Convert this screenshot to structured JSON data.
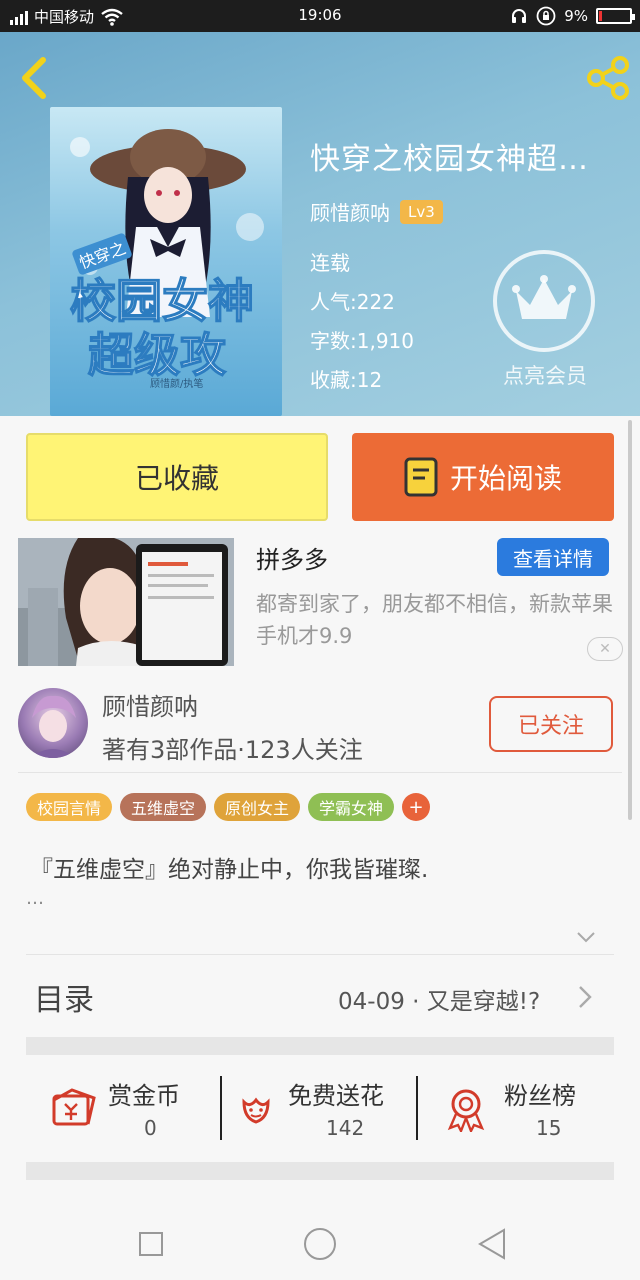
{
  "status_bar": {
    "carrier": "中国移动",
    "time": "19:06",
    "battery": "9%",
    "battery_level": 0.09
  },
  "book": {
    "title": "快穿之校园女神超…",
    "author": "顾惜颜呐",
    "level": "Lv3",
    "status": "连载",
    "popularity": "人气:222",
    "word_count": "字数:1,910",
    "favorites": "收藏:12",
    "vip_label": "点亮会员",
    "cover_text_top": "快穿之",
    "cover_text_line1": "校园女神",
    "cover_text_line2": "超级攻",
    "cover_author": "顾惜颜/执笔"
  },
  "actions": {
    "collected": "已收藏",
    "start_reading": "开始阅读"
  },
  "ad": {
    "title": "拼多多",
    "detail_button": "查看详情",
    "description": "都寄到家了，朋友都不相信，新款苹果手机才9.9",
    "close": "✕"
  },
  "author_card": {
    "name": "顾惜颜呐",
    "meta": "著有3部作品·123人关注",
    "follow_button": "已关注"
  },
  "tags": [
    {
      "label": "校园言情",
      "color": "#f3b748"
    },
    {
      "label": "五维虚空",
      "color": "#b7735a"
    },
    {
      "label": "原创女主",
      "color": "#dfa33a"
    },
    {
      "label": "学霸女神",
      "color": "#8fbf54"
    },
    {
      "label": "+",
      "color": "#e8633a"
    }
  ],
  "intro": {
    "text": "『五维虚空』绝对静止中，你我皆璀璨.",
    "ellipsis": "…"
  },
  "toc": {
    "label": "目录",
    "latest": "04-09 · 又是穿越!?"
  },
  "stats": {
    "reward": {
      "label": "赏金币",
      "value": "0"
    },
    "flowers": {
      "label": "免费送花",
      "value": "142"
    },
    "fans": {
      "label": "粉丝榜",
      "value": "15"
    }
  },
  "colors": {
    "accent_red": "#e05a3c",
    "read_button": "#ec6b36",
    "collect_button": "#fff475",
    "ad_button": "#2b7bde"
  }
}
